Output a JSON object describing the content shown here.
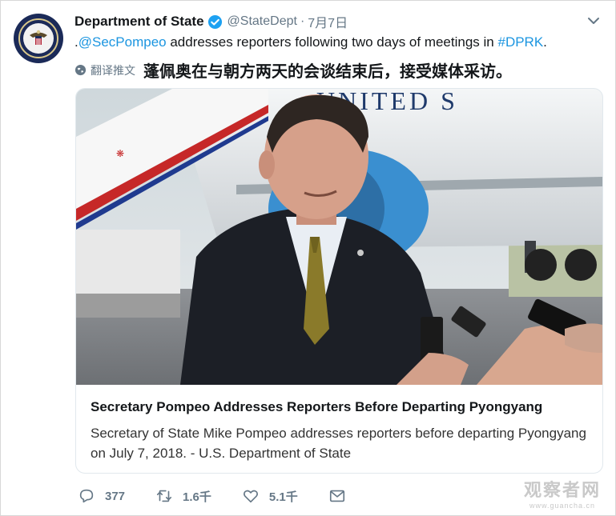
{
  "account": {
    "name": "Department of State",
    "handle": "@StateDept",
    "separator": "·",
    "date": "7月7日"
  },
  "tweet": {
    "prefix": ".",
    "mention": "@SecPompeo",
    "body": " addresses reporters following two days of meetings in ",
    "hashtag": "#DPRK",
    "suffix": "."
  },
  "translation": {
    "label": "翻译推文",
    "text": "蓬佩奥在与朝方两天的会谈结束后，接受媒体采访。"
  },
  "card": {
    "title": "Secretary Pompeo Addresses Reporters Before Departing Pyongyang",
    "description": "Secretary of State Mike Pompeo addresses reporters before departing Pyongyang on July 7, 2018. - U.S. Department of State",
    "plane_text": "UNITED S"
  },
  "actions": {
    "replies": "377",
    "retweets": "1.6千",
    "likes": "5.1千"
  },
  "watermark": {
    "main": "观察者网",
    "sub": "www.guancha.cn"
  },
  "colors": {
    "link": "#1b95e0",
    "secondary": "#657786",
    "verified": "#1da1f2"
  }
}
